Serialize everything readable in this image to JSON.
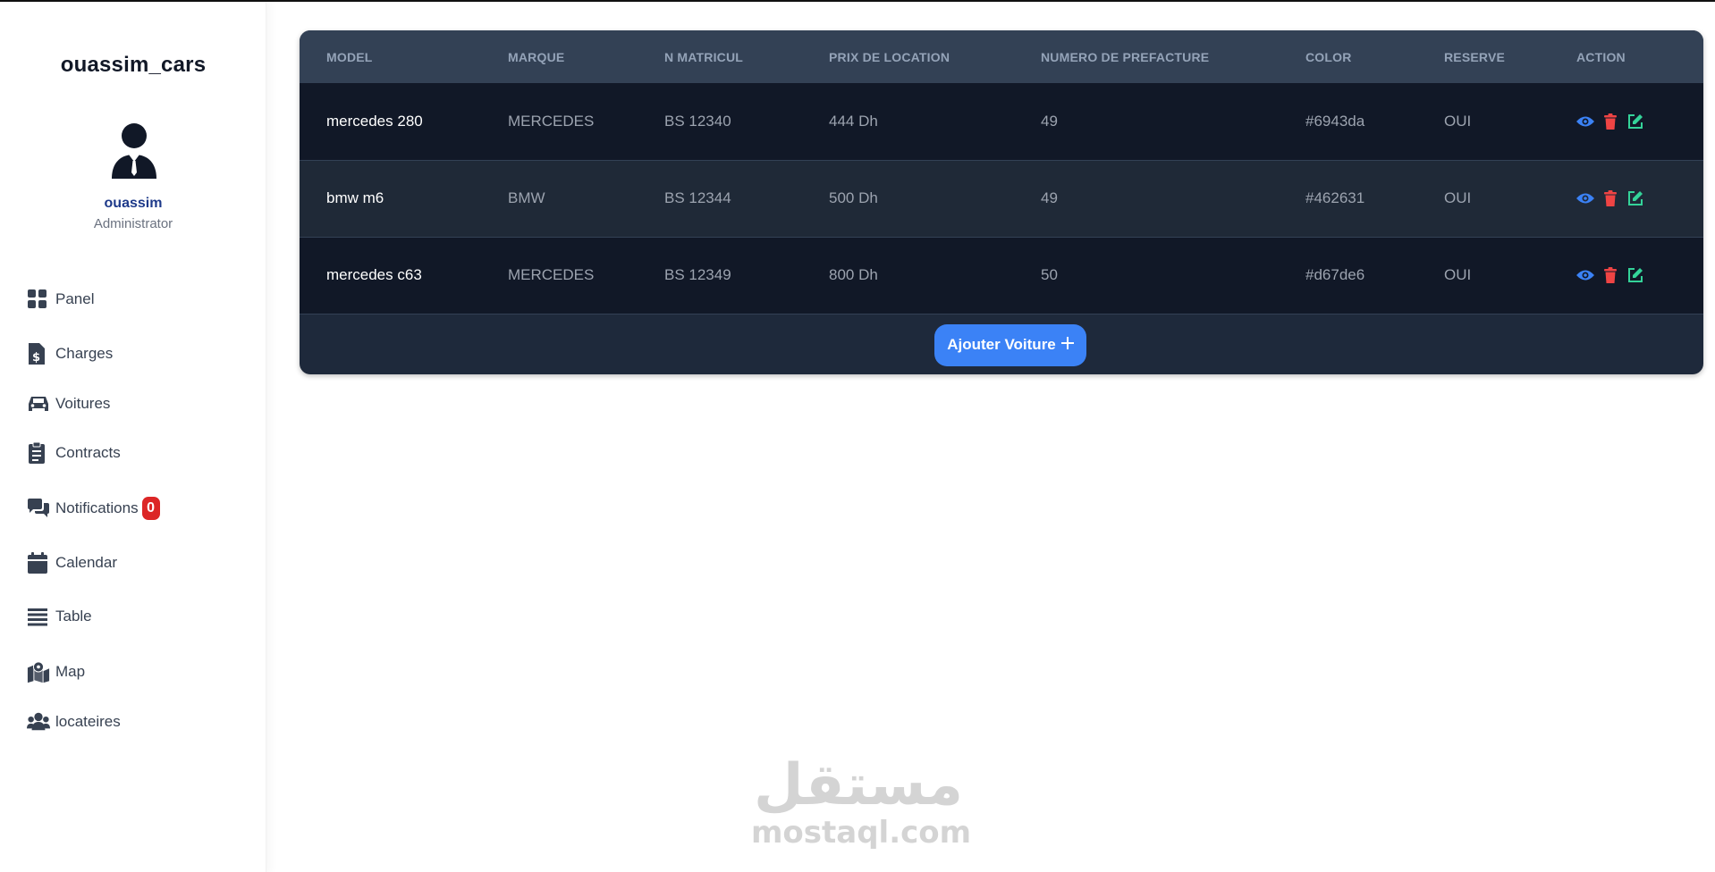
{
  "sidebar": {
    "brand": "ouassim_cars",
    "user": {
      "name": "ouassim",
      "role": "Administrator"
    },
    "items": [
      {
        "label": "Panel",
        "icon": "grid-icon"
      },
      {
        "label": "Charges",
        "icon": "invoice-dollar-icon"
      },
      {
        "label": "Voitures",
        "icon": "car-icon"
      },
      {
        "label": "Contracts",
        "icon": "clipboard-list-icon"
      },
      {
        "label": "Notifications",
        "icon": "comments-icon",
        "badge": "0"
      },
      {
        "label": "Calendar",
        "icon": "calendar-icon"
      },
      {
        "label": "Table",
        "icon": "list-lines-icon"
      },
      {
        "label": "Map",
        "icon": "map-location-icon"
      },
      {
        "label": "locateires",
        "icon": "users-icon"
      }
    ]
  },
  "table": {
    "headers": [
      "MODEL",
      "MARQUE",
      "N MATRICUL",
      "PRIX DE LOCATION",
      "NUMERO DE PREFACTURE",
      "COLOR",
      "RESERVE",
      "ACTION"
    ],
    "rows": [
      {
        "model": "mercedes 280",
        "marque": "MERCEDES",
        "matricul": "BS 12340",
        "prix": "444 Dh",
        "prefacture": "49",
        "color": "#6943da",
        "reserve": "OUI"
      },
      {
        "model": "bmw m6",
        "marque": "BMW",
        "matricul": "BS 12344",
        "prix": "500 Dh",
        "prefacture": "49",
        "color": "#462631",
        "reserve": "OUI"
      },
      {
        "model": "mercedes c63",
        "marque": "MERCEDES",
        "matricul": "BS 12349",
        "prix": "800 Dh",
        "prefacture": "50",
        "color": "#d67de6",
        "reserve": "OUI"
      }
    ],
    "add_button": "Ajouter Voiture"
  },
  "watermark": {
    "arabic": "مستقل",
    "latin": "mostaql.com"
  },
  "colors": {
    "view": "#3b82f6",
    "delete": "#ef4444",
    "edit": "#34d399",
    "badge": "#dc2626",
    "user_name": "#1e3a8a"
  }
}
